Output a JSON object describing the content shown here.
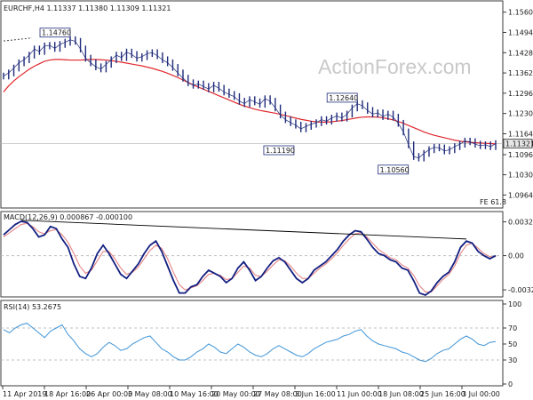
{
  "colors": {
    "price": "#1f2b7a",
    "sma": "#e0282e",
    "macd": "#121f80",
    "signal": "#e57a7a",
    "rsi": "#3f95d8",
    "frame": "#3a3a3a",
    "grid": "#bfbfbf",
    "trendline": "#000000",
    "current_price_box": "#e6e6e6"
  },
  "watermark": "ActionForex.com",
  "chart_data": [
    {
      "type": "candlestick",
      "title": "EURCHF,H4  1.11337 1.11380 1.11309 1.11321",
      "ylim": [
        1.0928,
        1.1588
      ],
      "y_ticks": [
        "1.15600",
        "1.14940",
        "1.14280",
        "1.13620",
        "1.12960",
        "1.12300",
        "1.11640",
        "1.10960",
        "1.10305",
        "1.09645"
      ],
      "current_price": "1.11321",
      "fib_label": "FE 61.8",
      "annotations": [
        {
          "label": "1.14760",
          "value": 1.1476
        },
        {
          "label": "1.12640",
          "value": 1.1264
        },
        {
          "label": "1.11190",
          "value": 1.1119
        },
        {
          "label": "1.10560",
          "value": 1.1056
        }
      ],
      "close": [
        1.1352,
        1.1362,
        1.1378,
        1.1395,
        1.1405,
        1.142,
        1.144,
        1.1432,
        1.145,
        1.1452,
        1.1442,
        1.1455,
        1.1462,
        1.147,
        1.1465,
        1.144,
        1.141,
        1.1395,
        1.1382,
        1.1375,
        1.139,
        1.1405,
        1.142,
        1.1412,
        1.143,
        1.1422,
        1.141,
        1.1415,
        1.1425,
        1.1428,
        1.1418,
        1.1405,
        1.1395,
        1.138,
        1.1362,
        1.1345,
        1.133,
        1.1322,
        1.1326,
        1.1318,
        1.131,
        1.1322,
        1.1312,
        1.13,
        1.1292,
        1.1285,
        1.127,
        1.1262,
        1.1275,
        1.1268,
        1.126,
        1.1278,
        1.127,
        1.1248,
        1.1225,
        1.121,
        1.12,
        1.1192,
        1.118,
        1.1188,
        1.1195,
        1.12,
        1.121,
        1.1205,
        1.1215,
        1.1222,
        1.1215,
        1.1228,
        1.1248,
        1.1262,
        1.1255,
        1.124,
        1.1228,
        1.1232,
        1.122,
        1.1228,
        1.1218,
        1.1198,
        1.117,
        1.1128,
        1.109,
        1.1085,
        1.11,
        1.1112,
        1.112,
        1.1118,
        1.1108,
        1.1112,
        1.1122,
        1.113,
        1.114,
        1.1138,
        1.113,
        1.1125,
        1.1128,
        1.1122,
        1.1132
      ],
      "sma": [
        1.13,
        1.132,
        1.1336,
        1.135,
        1.1362,
        1.1374,
        1.1384,
        1.1392,
        1.14,
        1.1404,
        1.1406,
        1.1406,
        1.1405,
        1.1404,
        1.1404,
        1.1404,
        1.1405,
        1.1406,
        1.1406,
        1.1405,
        1.1404,
        1.1402,
        1.14,
        1.1397,
        1.1394,
        1.1391,
        1.1388,
        1.1385,
        1.1381,
        1.1377,
        1.1372,
        1.1367,
        1.1361,
        1.1354,
        1.1347,
        1.1339,
        1.1331,
        1.1323,
        1.1316,
        1.1309,
        1.1302,
        1.1295,
        1.1288,
        1.1281,
        1.1274,
        1.1267,
        1.126,
        1.1254,
        1.1249,
        1.1244,
        1.124,
        1.1237,
        1.1234,
        1.1231,
        1.1227,
        1.1223,
        1.1219,
        1.1215,
        1.1211,
        1.1208,
        1.1205,
        1.1203,
        1.1202,
        1.1202,
        1.1203,
        1.1205,
        1.1207,
        1.121,
        1.1213,
        1.1216,
        1.1218,
        1.1219,
        1.1219,
        1.1218,
        1.1216,
        1.1213,
        1.1209,
        1.1204,
        1.1198,
        1.1191,
        1.1184,
        1.1177,
        1.117,
        1.1164,
        1.1159,
        1.1155,
        1.1151,
        1.1147,
        1.1143,
        1.114,
        1.1138,
        1.1136,
        1.1135,
        1.1134,
        1.1133,
        1.1132,
        1.1131
      ]
    },
    {
      "type": "line",
      "title": "MACD(12,26,9) 0.000867 -0.000100",
      "ylim": [
        -0.0038,
        0.0039
      ],
      "y_ticks": [
        "0.003249",
        "0.00",
        "-0.003293"
      ],
      "macd": [
        0.002,
        0.0025,
        0.003,
        0.0033,
        0.0032,
        0.0026,
        0.0018,
        0.002,
        0.0028,
        0.0026,
        0.0016,
        0.0008,
        -0.0008,
        -0.002,
        -0.0022,
        -0.0012,
        0.0002,
        0.001,
        0.0002,
        -0.0008,
        -0.0018,
        -0.0022,
        -0.0015,
        -0.0008,
        0.0002,
        0.001,
        0.0014,
        0.0004,
        -0.001,
        -0.0024,
        -0.0036,
        -0.0036,
        -0.003,
        -0.0028,
        -0.002,
        -0.0014,
        -0.0017,
        -0.002,
        -0.0026,
        -0.0022,
        -0.0012,
        -0.0006,
        -0.0014,
        -0.0024,
        -0.002,
        -0.0012,
        -0.0005,
        -0.0002,
        -0.0006,
        -0.0014,
        -0.0022,
        -0.0026,
        -0.0022,
        -0.0014,
        -0.001,
        -0.0006,
        0.0,
        0.0006,
        0.0014,
        0.002,
        0.0024,
        0.0023,
        0.0016,
        0.0008,
        0.0002,
        0.0,
        -0.0004,
        -0.0006,
        -0.0012,
        -0.0014,
        -0.0024,
        -0.0036,
        -0.0038,
        -0.0034,
        -0.0026,
        -0.002,
        -0.0016,
        -0.0006,
        0.0008,
        0.0014,
        0.0012,
        0.0004,
        0.0,
        -0.0003,
        0.0
      ],
      "signal": [
        0.0018,
        0.0022,
        0.0026,
        0.003,
        0.0031,
        0.0028,
        0.0023,
        0.0021,
        0.0024,
        0.0025,
        0.002,
        0.0013,
        0.0002,
        -0.001,
        -0.0017,
        -0.0014,
        -0.0005,
        0.0004,
        0.0004,
        -0.0003,
        -0.0012,
        -0.0018,
        -0.0016,
        -0.0011,
        -0.0003,
        0.0005,
        0.001,
        0.0007,
        -0.0003,
        -0.0016,
        -0.0028,
        -0.0033,
        -0.0031,
        -0.0029,
        -0.0024,
        -0.0018,
        -0.0017,
        -0.0019,
        -0.0023,
        -0.0022,
        -0.0016,
        -0.001,
        -0.0012,
        -0.0019,
        -0.002,
        -0.0015,
        -0.0009,
        -0.0004,
        -0.0005,
        -0.001,
        -0.0017,
        -0.0022,
        -0.0022,
        -0.0017,
        -0.0012,
        -0.0008,
        -0.0003,
        0.0003,
        0.001,
        0.0016,
        0.0021,
        0.0022,
        0.0018,
        0.0012,
        0.0006,
        0.0002,
        -0.0002,
        -0.0004,
        -0.0009,
        -0.0012,
        -0.0019,
        -0.0029,
        -0.0035,
        -0.0035,
        -0.0029,
        -0.0023,
        -0.0018,
        -0.001,
        0.0002,
        0.001,
        0.0012,
        0.0007,
        0.0002,
        -0.0001,
        -0.0001
      ]
    },
    {
      "type": "line",
      "title": "RSI(14) 53.2675",
      "ylim": [
        0,
        100
      ],
      "y_ticks": [
        "100",
        "70",
        "50",
        "30",
        "0"
      ],
      "levels": [
        70,
        30
      ],
      "values": [
        68,
        64,
        70,
        74,
        76,
        70,
        64,
        58,
        66,
        70,
        74,
        62,
        54,
        44,
        38,
        34,
        38,
        46,
        52,
        48,
        42,
        44,
        50,
        54,
        58,
        60,
        52,
        44,
        40,
        34,
        30,
        30,
        34,
        40,
        44,
        50,
        46,
        40,
        38,
        44,
        50,
        46,
        40,
        36,
        34,
        38,
        44,
        48,
        44,
        40,
        36,
        34,
        38,
        44,
        48,
        52,
        54,
        56,
        60,
        62,
        66,
        68,
        60,
        54,
        50,
        48,
        46,
        44,
        40,
        38,
        34,
        30,
        28,
        32,
        38,
        42,
        44,
        50,
        56,
        60,
        56,
        50,
        48,
        52,
        53
      ],
      "x_tick_labels": [
        "11 Apr 2019",
        "18 Apr 16:00",
        "26 Apr 00:00",
        "3 May 08:00",
        "10 May 16:00",
        "20 May 00:00",
        "27 May 08:00",
        "3 Jun 16:00",
        "11 Jun 00:00",
        "18 Jun 08:00",
        "25 Jun 16:00",
        "3 Jul 00:00"
      ]
    }
  ]
}
